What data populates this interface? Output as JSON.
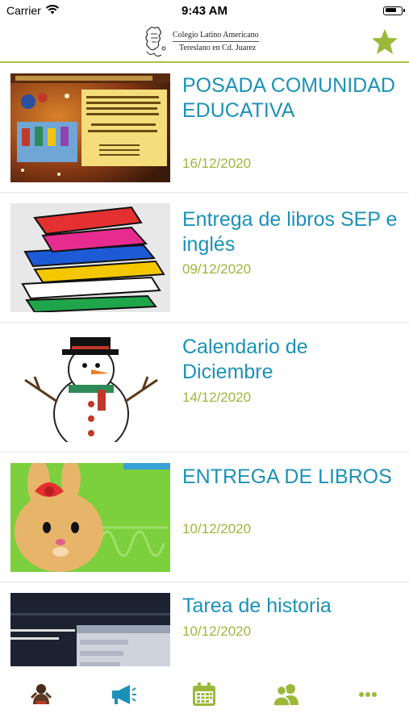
{
  "status_bar": {
    "carrier": "Carrier",
    "time": "9:43 AM"
  },
  "header": {
    "logo_line1": "Colegio Latino Americano",
    "logo_line2": "Tereslano en Cd. Juarez",
    "favorite_icon": "star-icon"
  },
  "colors": {
    "accent_green": "#9bb83a",
    "title_blue": "#1c91b8",
    "header_line": "#a7c23a"
  },
  "items": [
    {
      "title": "POSADA COMUNIDAD EDUCATIVA",
      "date": "16/12/2020",
      "thumbnail": "posada-flyer-image"
    },
    {
      "title": "Entrega de libros SEP e inglés",
      "date": "09/12/2020",
      "thumbnail": "books-stack-image"
    },
    {
      "title": "Calendario de Diciembre",
      "date": "14/12/2020",
      "thumbnail": "snowman-image"
    },
    {
      "title": "ENTREGA DE LIBROS",
      "date": "10/12/2020",
      "thumbnail": "bunny-cartoon-image"
    },
    {
      "title": "Tarea de historia",
      "date": "10/12/2020",
      "thumbnail": "history-slide-image"
    }
  ],
  "tabbar": {
    "tabs": [
      {
        "icon": "school-mascot-icon"
      },
      {
        "icon": "megaphone-icon"
      },
      {
        "icon": "calendar-icon"
      },
      {
        "icon": "contacts-icon"
      },
      {
        "icon": "more-icon"
      }
    ]
  }
}
